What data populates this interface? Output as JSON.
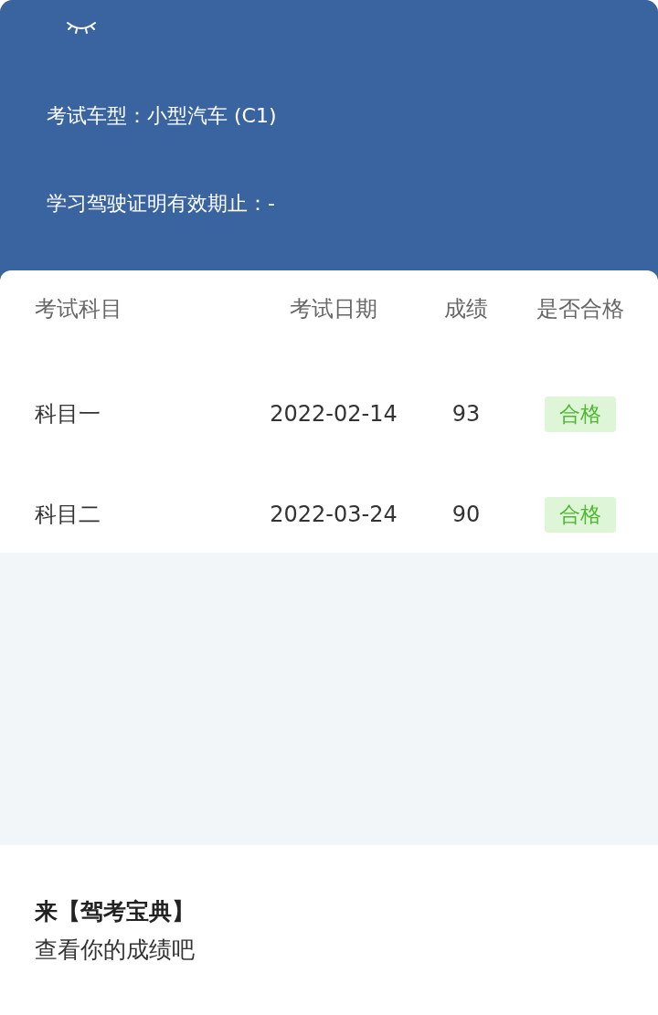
{
  "header": {
    "hidden": true,
    "fields": [
      {
        "label": "考试车型：",
        "value": "小型汽车 (C1)"
      },
      {
        "label": "学习驾驶证明有效期止：",
        "value": "-"
      }
    ]
  },
  "table": {
    "columns": [
      "考试科目",
      "考试日期",
      "成绩",
      "是否合格"
    ],
    "rows": [
      {
        "subject": "科目一",
        "date": "2022-02-14",
        "score": "93",
        "result": "合格",
        "passed": true
      },
      {
        "subject": "科目二",
        "date": "2022-03-24",
        "score": "90",
        "result": "合格",
        "passed": true
      }
    ]
  },
  "footer": {
    "title": "来【驾考宝典】",
    "subtitle": "查看你的成绩吧"
  }
}
